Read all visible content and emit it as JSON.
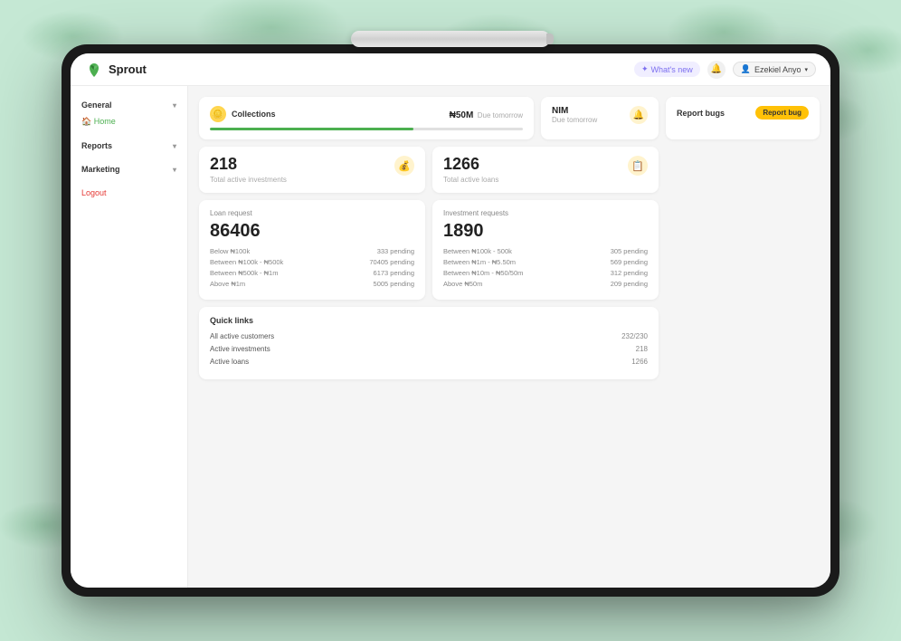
{
  "background": {
    "color": "#c5e8d4"
  },
  "tablet": {
    "stylus": "stylus"
  },
  "topNav": {
    "logo": {
      "text": "Sprout"
    },
    "whatsNew": "What's new",
    "user": "Ezekiel Anyo"
  },
  "sidebar": {
    "sections": [
      {
        "title": "General",
        "items": [
          "Home"
        ]
      },
      {
        "title": "Reports",
        "items": []
      },
      {
        "title": "Marketing",
        "items": []
      }
    ],
    "activeItem": "Home",
    "logout": "Logout"
  },
  "collections": {
    "title": "Collections",
    "value": "₦50M",
    "subtitle": "Due tomorrow",
    "progressPercent": 65
  },
  "nim": {
    "label": "NIM",
    "sublabel": "Due tomorrow"
  },
  "reportBugs": {
    "title": "Report bugs",
    "buttonLabel": "Report bug"
  },
  "stats": [
    {
      "number": "218",
      "label": "Total active investments",
      "icon": "💰"
    },
    {
      "number": "1266",
      "label": "Total active loans",
      "icon": "📋"
    }
  ],
  "loanRequest": {
    "title": "Loan request",
    "number": "86406",
    "rows": [
      {
        "range": "Below ₦100k",
        "pending": "333 pending"
      },
      {
        "range": "Between ₦100k - ₦500k",
        "pending": "70405 pending"
      },
      {
        "range": "Between ₦500k - ₦1m",
        "pending": "6173 pending"
      },
      {
        "range": "Above ₦1m",
        "pending": "5005 pending"
      }
    ]
  },
  "investmentRequest": {
    "title": "Investment requests",
    "number": "1890",
    "rows": [
      {
        "range": "Between ₦100k - 500k",
        "pending": "305 pending"
      },
      {
        "range": "Between ₦1m - ₦5.50m",
        "pending": "569 pending"
      },
      {
        "range": "Between ₦10m - ₦50/50m",
        "pending": "312 pending"
      },
      {
        "range": "Above ₦50m",
        "pending": "209 pending"
      }
    ]
  },
  "quickLinks": {
    "title": "Quick links",
    "items": [
      {
        "label": "All active customers",
        "value": "232/230"
      },
      {
        "label": "Active investments",
        "value": "218"
      },
      {
        "label": "Active loans",
        "value": "1266"
      }
    ]
  }
}
